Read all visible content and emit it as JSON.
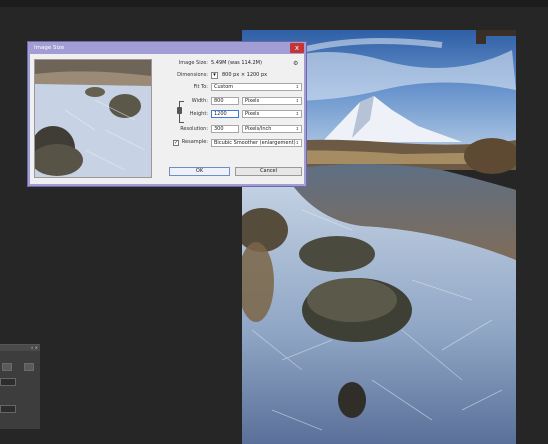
{
  "dialog": {
    "title": "Image Size",
    "close_label": "x",
    "image_size_label": "Image Size:",
    "image_size_value": "5.49M (was 114.2M)",
    "dimensions_label": "Dimensions:",
    "dimensions_value": "800 px  ×  1200 px",
    "fit_to_label": "Fit To:",
    "fit_to_value": "Custom",
    "width_label": "Width:",
    "width_value": "800",
    "width_unit": "Pixels",
    "height_label": "Height:",
    "height_value": "1200",
    "height_unit": "Pixels",
    "resolution_label": "Resolution:",
    "resolution_value": "300",
    "resolution_unit": "Pixels/Inch",
    "resample_label": "Resample:",
    "resample_checked": true,
    "resample_value": "Bicubic Smoother (enlargement)",
    "ok_label": "OK",
    "cancel_label": "Cancel",
    "dimensions_dropdown_glyph": "▾",
    "select_arrow_glyph": "↕",
    "gear_glyph": "⚙"
  },
  "colors": {
    "dialog_frame": "#a39dd6",
    "close_button": "#c73434",
    "workspace": "#262626"
  }
}
